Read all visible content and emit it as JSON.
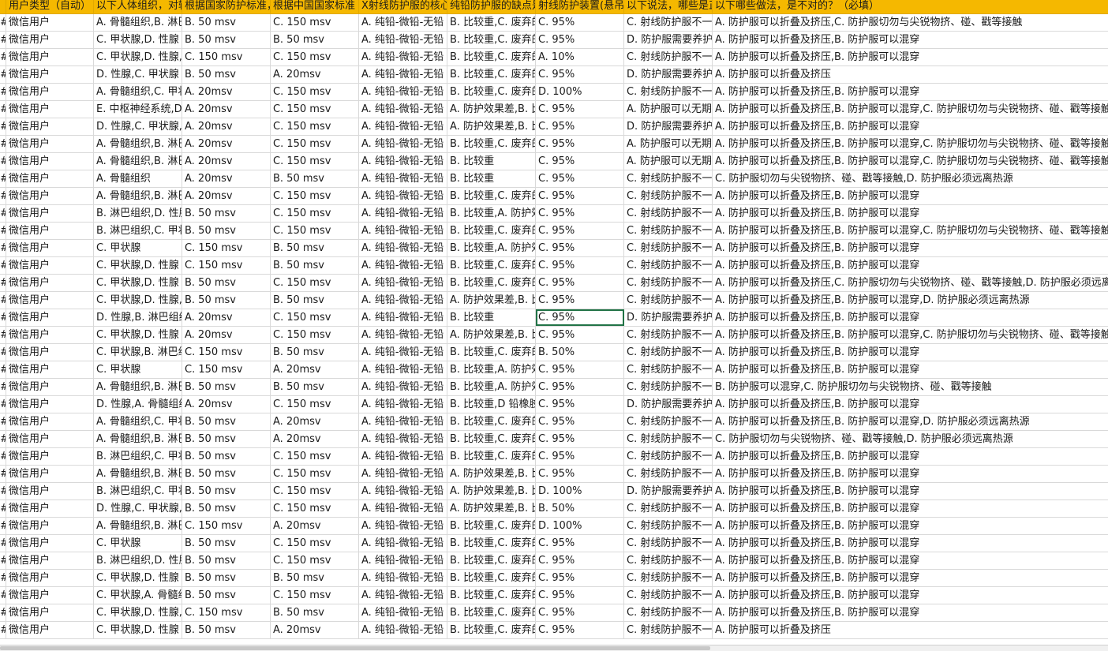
{
  "columns": [
    "用户类型（自动）",
    "以下人体组织，对辐射最敏感的是？",
    "根据国家防护标准，",
    "根据中国国家标准",
    "X射线防护服的核心",
    "纯铅防护服的缺点是",
    "射线防护装置(悬吊",
    "以下说法，哪些是正",
    "以下哪些做法，是不对的？（必填）"
  ],
  "rowMarker": "#",
  "selectedCell": {
    "row": 17,
    "col": 6
  },
  "rows": [
    [
      "微信用户",
      "A. 骨髓组织,B. 淋巴",
      "B. 50 msv",
      "C. 150 msv",
      "A. 纯铅-微铅-无铅",
      "B. 比较重,C. 废弃的",
      "C. 95%",
      "C. 射线防护服不一",
      "A. 防护服可以折叠及挤压,C. 防护服切勿与尖锐物挤、碰、戳等接触"
    ],
    [
      "微信用户",
      "C. 甲状腺,D. 性腺",
      "B. 50 msv",
      "B. 50 msv",
      "A. 纯铅-微铅-无铅",
      "B. 比较重,C. 废弃的",
      "C. 95%",
      "D. 防护服需要养护",
      "A. 防护服可以折叠及挤压,B. 防护服可以混穿"
    ],
    [
      "微信用户",
      "C. 甲状腺,D. 性腺,A",
      "C. 150 msv",
      "C. 150 msv",
      "A. 纯铅-微铅-无铅",
      "B. 比较重,C. 废弃的",
      "A. 10%",
      "C. 射线防护服不一",
      "A. 防护服可以折叠及挤压,B. 防护服可以混穿"
    ],
    [
      "微信用户",
      "D. 性腺,C. 甲状腺",
      "B. 50 msv",
      "A. 20msv",
      "A. 纯铅-微铅-无铅",
      "B. 比较重,C. 废弃的",
      "C. 95%",
      "D. 防护服需要养护",
      "A. 防护服可以折叠及挤压"
    ],
    [
      "微信用户",
      "A. 骨髓组织,C. 甲状",
      "A. 20msv",
      "C. 150 msv",
      "A. 纯铅-微铅-无铅",
      "B. 比较重,C. 废弃的",
      "D. 100%",
      "C. 射线防护服不一",
      "A. 防护服可以折叠及挤压,B. 防护服可以混穿"
    ],
    [
      "微信用户",
      "E. 中枢神经系统,D.",
      "A. 20msv",
      "C. 150 msv",
      "A. 纯铅-微铅-无铅",
      "A. 防护效果差,B. 比",
      "C. 95%",
      "A. 防护服可以无期",
      "A. 防护服可以折叠及挤压,B. 防护服可以混穿,C. 防护服切勿与尖锐物挤、碰、戳等接触,"
    ],
    [
      "微信用户",
      "D. 性腺,C. 甲状腺,A",
      "A. 20msv",
      "C. 150 msv",
      "A. 纯铅-微铅-无铅",
      "A. 防护效果差,B. 比",
      "C. 95%",
      "D. 防护服需要养护",
      "A. 防护服可以折叠及挤压,B. 防护服可以混穿"
    ],
    [
      "微信用户",
      "A. 骨髓组织,B. 淋巴",
      "A. 20msv",
      "C. 150 msv",
      "A. 纯铅-微铅-无铅",
      "B. 比较重,C. 废弃的",
      "C. 95%",
      "A. 防护服可以无期",
      "A. 防护服可以折叠及挤压,B. 防护服可以混穿,C. 防护服切勿与尖锐物挤、碰、戳等接触,"
    ],
    [
      "微信用户",
      "A. 骨髓组织,B. 淋巴",
      "A. 20msv",
      "C. 150 msv",
      "A. 纯铅-微铅-无铅",
      "B. 比较重",
      "C. 95%",
      "A. 防护服可以无期",
      "A. 防护服可以折叠及挤压,B. 防护服可以混穿,C. 防护服切勿与尖锐物挤、碰、戳等接触,"
    ],
    [
      "微信用户",
      "A. 骨髓组织",
      "A. 20msv",
      "B. 50 msv",
      "A. 纯铅-微铅-无铅",
      "B. 比较重",
      "C. 95%",
      "C. 射线防护服不一",
      "C. 防护服切勿与尖锐物挤、碰、戳等接触,D. 防护服必须远离热源"
    ],
    [
      "微信用户",
      "A. 骨髓组织,B. 淋巴",
      "A. 20msv",
      "C. 150 msv",
      "A. 纯铅-微铅-无铅",
      "B. 比较重,C. 废弃的",
      "C. 95%",
      "C. 射线防护服不一",
      "A. 防护服可以折叠及挤压,B. 防护服可以混穿"
    ],
    [
      "微信用户",
      "B. 淋巴组织,D. 性腺",
      "B. 50 msv",
      "C. 150 msv",
      "A. 纯铅-微铅-无铅",
      "B. 比较重,A. 防护效",
      "C. 95%",
      "C. 射线防护服不一",
      "A. 防护服可以折叠及挤压,B. 防护服可以混穿"
    ],
    [
      "微信用户",
      "B. 淋巴组织,C. 甲状",
      "B. 50 msv",
      "C. 150 msv",
      "A. 纯铅-微铅-无铅",
      "B. 比较重,C. 废弃的",
      "C. 95%",
      "C. 射线防护服不一",
      "A. 防护服可以折叠及挤压,B. 防护服可以混穿,C. 防护服切勿与尖锐物挤、碰、戳等接触"
    ],
    [
      "微信用户",
      "C. 甲状腺",
      "C. 150 msv",
      "B. 50 msv",
      "A. 纯铅-微铅-无铅",
      "B. 比较重,A. 防护效",
      "C. 95%",
      "C. 射线防护服不一",
      "A. 防护服可以折叠及挤压,B. 防护服可以混穿"
    ],
    [
      "微信用户",
      "C. 甲状腺,D. 性腺",
      "C. 150 msv",
      "B. 50 msv",
      "A. 纯铅-微铅-无铅",
      "B. 比较重,C. 废弃的",
      "C. 95%",
      "C. 射线防护服不一",
      "A. 防护服可以折叠及挤压,B. 防护服可以混穿"
    ],
    [
      "微信用户",
      "C. 甲状腺,D. 性腺",
      "B. 50 msv",
      "C. 150 msv",
      "A. 纯铅-微铅-无铅",
      "B. 比较重,C. 废弃的",
      "C. 95%",
      "C. 射线防护服不一",
      "A. 防护服可以折叠及挤压,C. 防护服切勿与尖锐物挤、碰、戳等接触,D. 防护服必须远离"
    ],
    [
      "微信用户",
      "C. 甲状腺,D. 性腺,A",
      "B. 50 msv",
      "B. 50 msv",
      "A. 纯铅-微铅-无铅",
      "A. 防护效果差,B. 比",
      "C. 95%",
      "C. 射线防护服不一",
      "A. 防护服可以折叠及挤压,B. 防护服可以混穿,D. 防护服必须远离热源"
    ],
    [
      "微信用户",
      "D. 性腺,B. 淋巴组织",
      "A. 20msv",
      "C. 150 msv",
      "A. 纯铅-微铅-无铅",
      "B. 比较重",
      "C. 95%",
      "D. 防护服需要养护",
      "A. 防护服可以折叠及挤压,B. 防护服可以混穿"
    ],
    [
      "微信用户",
      "C. 甲状腺,D. 性腺",
      "A. 20msv",
      "C. 150 msv",
      "A. 纯铅-微铅-无铅",
      "A. 防护效果差,B. 比",
      "C. 95%",
      "C. 射线防护服不一",
      "A. 防护服可以折叠及挤压,B. 防护服可以混穿,C. 防护服切勿与尖锐物挤、碰、戳等接触"
    ],
    [
      "微信用户",
      "C. 甲状腺,B. 淋巴组",
      "C. 150 msv",
      "B. 50 msv",
      "A. 纯铅-微铅-无铅",
      "B. 比较重,C. 废弃的",
      "B. 50%",
      "C. 射线防护服不一",
      "A. 防护服可以折叠及挤压,B. 防护服可以混穿"
    ],
    [
      "微信用户",
      "C. 甲状腺",
      "C. 150 msv",
      "A. 20msv",
      "A. 纯铅-微铅-无铅",
      "B. 比较重,A. 防护效",
      "C. 95%",
      "C. 射线防护服不一",
      "A. 防护服可以折叠及挤压,B. 防护服可以混穿"
    ],
    [
      "微信用户",
      "A. 骨髓组织,B. 淋巴",
      "B. 50 msv",
      "B. 50 msv",
      "A. 纯铅-微铅-无铅",
      "B. 比较重,A. 防护效",
      "C. 95%",
      "C. 射线防护服不一",
      "B. 防护服可以混穿,C. 防护服切勿与尖锐物挤、碰、戳等接触"
    ],
    [
      "微信用户",
      "D. 性腺,A. 骨髓组织",
      "A. 20msv",
      "C. 150 msv",
      "A. 纯铅-微铅-无铅",
      "B. 比较重,D 铅橡胶",
      "C. 95%",
      "D. 防护服需要养护",
      "A. 防护服可以折叠及挤压,B. 防护服可以混穿"
    ],
    [
      "微信用户",
      "A. 骨髓组织,C. 甲状",
      "B. 50 msv",
      "A. 20msv",
      "A. 纯铅-微铅-无铅",
      "B. 比较重,C. 废弃的",
      "C. 95%",
      "C. 射线防护服不一",
      "A. 防护服可以折叠及挤压,B. 防护服可以混穿,D. 防护服必须远离热源"
    ],
    [
      "微信用户",
      "A. 骨髓组织,B. 淋巴",
      "B. 50 msv",
      "A. 20msv",
      "A. 纯铅-微铅-无铅",
      "B. 比较重,C. 废弃的",
      "C. 95%",
      "C. 射线防护服不一",
      "C. 防护服切勿与尖锐物挤、碰、戳等接触,D. 防护服必须远离热源"
    ],
    [
      "微信用户",
      "B. 淋巴组织,C. 甲状",
      "B. 50 msv",
      "C. 150 msv",
      "A. 纯铅-微铅-无铅",
      "B. 比较重,C. 废弃的",
      "C. 95%",
      "C. 射线防护服不一",
      "A. 防护服可以折叠及挤压,B. 防护服可以混穿"
    ],
    [
      "微信用户",
      "A. 骨髓组织,B. 淋巴",
      "B. 50 msv",
      "C. 150 msv",
      "A. 纯铅-微铅-无铅",
      "A. 防护效果差,B. 比",
      "C. 95%",
      "C. 射线防护服不一",
      "A. 防护服可以折叠及挤压,B. 防护服可以混穿"
    ],
    [
      "微信用户",
      "B. 淋巴组织,C. 甲状",
      "B. 50 msv",
      "C. 150 msv",
      "A. 纯铅-微铅-无铅",
      "A. 防护效果差,B. 比",
      "D. 100%",
      "D. 防护服需要养护",
      "A. 防护服可以折叠及挤压,B. 防护服可以混穿"
    ],
    [
      "微信用户",
      "D. 性腺,C. 甲状腺,B",
      "B. 50 msv",
      "C. 150 msv",
      "A. 纯铅-微铅-无铅",
      "A. 防护效果差,B. 比",
      "B. 50%",
      "C. 射线防护服不一",
      "A. 防护服可以折叠及挤压,B. 防护服可以混穿"
    ],
    [
      "微信用户",
      "A. 骨髓组织,B. 淋巴",
      "C. 150 msv",
      "A. 20msv",
      "A. 纯铅-微铅-无铅",
      "B. 比较重,C. 废弃的",
      "D. 100%",
      "C. 射线防护服不一",
      "A. 防护服可以折叠及挤压,B. 防护服可以混穿"
    ],
    [
      "微信用户",
      "C. 甲状腺",
      "B. 50 msv",
      "C. 150 msv",
      "A. 纯铅-微铅-无铅",
      "B. 比较重,C. 废弃的",
      "C. 95%",
      "C. 射线防护服不一",
      "A. 防护服可以折叠及挤压,B. 防护服可以混穿"
    ],
    [
      "微信用户",
      "B. 淋巴组织,D. 性腺",
      "B. 50 msv",
      "C. 150 msv",
      "A. 纯铅-微铅-无铅",
      "B. 比较重,C. 废弃的",
      "C. 95%",
      "C. 射线防护服不一",
      "A. 防护服可以折叠及挤压,B. 防护服可以混穿"
    ],
    [
      "微信用户",
      "C. 甲状腺,D. 性腺",
      "B. 50 msv",
      "B. 50 msv",
      "A. 纯铅-微铅-无铅",
      "B. 比较重,C. 废弃的",
      "C. 95%",
      "C. 射线防护服不一",
      "A. 防护服可以折叠及挤压,B. 防护服可以混穿"
    ],
    [
      "微信用户",
      "C. 甲状腺,A. 骨髓组",
      "B. 50 msv",
      "C. 150 msv",
      "A. 纯铅-微铅-无铅",
      "B. 比较重,C. 废弃的",
      "C. 95%",
      "C. 射线防护服不一",
      "A. 防护服可以折叠及挤压,B. 防护服可以混穿"
    ],
    [
      "微信用户",
      "C. 甲状腺,D. 性腺,A",
      "C. 150 msv",
      "B. 50 msv",
      "A. 纯铅-微铅-无铅",
      "B. 比较重,C. 废弃的",
      "C. 95%",
      "C. 射线防护服不一",
      "A. 防护服可以折叠及挤压,B. 防护服可以混穿"
    ],
    [
      "微信用户",
      "C. 甲状腺,D. 性腺",
      "B. 50 msv",
      "A. 20msv",
      "A. 纯铅-微铅-无铅",
      "B. 比较重,C. 废弃的",
      "C. 95%",
      "C. 射线防护服不一",
      "A. 防护服可以折叠及挤压"
    ]
  ]
}
